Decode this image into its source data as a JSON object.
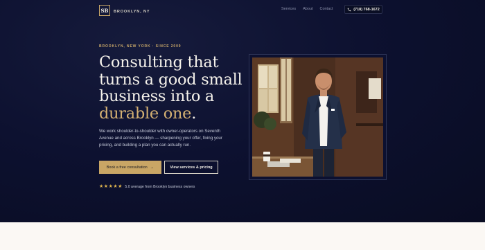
{
  "nav": {
    "logo_mark": "SB",
    "brand": "BROOKLYN, NY",
    "links": [
      "Services",
      "About",
      "Contact"
    ],
    "phone": "(718) 768-1672"
  },
  "hero": {
    "eyebrow": "BROOKLYN, NEW YORK · SINCE 2009",
    "headline_line1": "Consulting that",
    "headline_line2": "turns a good small",
    "headline_line3": "business into a",
    "headline_gold": "durable one",
    "headline_end": ".",
    "description": "We work shoulder-to-shoulder with owner-operators on Seventh Avenue and across Brooklyn — sharpening your offer, fixing your pricing, and building a plan you can actually run.",
    "primary_cta": "Book a free consultation",
    "primary_cta_arrow": "→",
    "secondary_cta": "View services & pricing",
    "stars": [
      "★",
      "★",
      "★",
      "★",
      "★"
    ],
    "rating_text": "5.0 average from Brooklyn business owners"
  },
  "colors": {
    "navy": "#0d1130",
    "gold": "#c9a869",
    "cream": "#fbf8f4"
  },
  "icons": {
    "phone": "phone-icon",
    "star": "star-icon",
    "arrow": "arrow-right-icon"
  }
}
